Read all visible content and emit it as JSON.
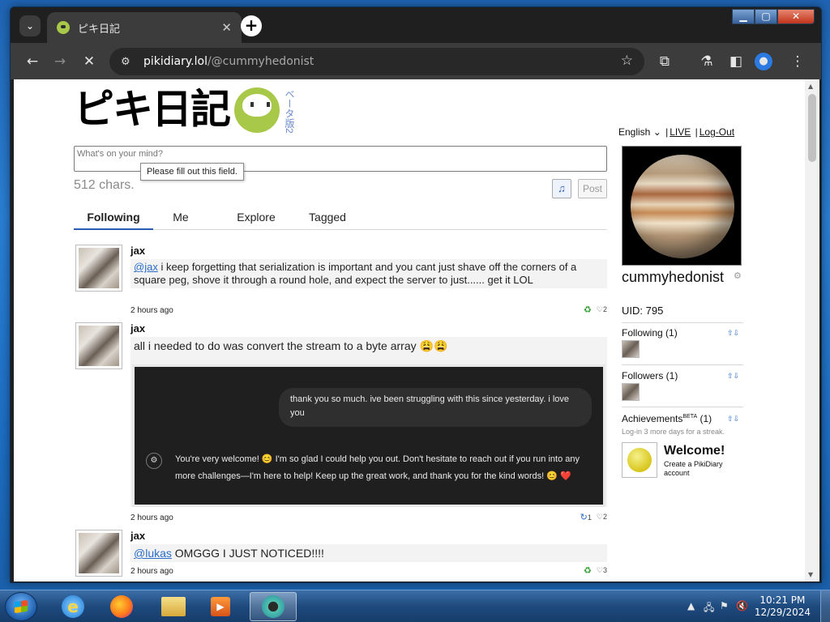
{
  "browser": {
    "tab_title": "ピキ日記",
    "tab_close": "✕",
    "new_tab": "+",
    "url_host": "pikidiary.lol",
    "url_path": "/@cummyhedonist"
  },
  "window_controls": {
    "minimize": "▁",
    "maximize": "▢",
    "close": "✕"
  },
  "header": {
    "logo_text": "ピキ日記",
    "beta_label": "ベータ版2",
    "language": "English",
    "language_caret": "⌄",
    "live_link": "LIVE",
    "logout_link": "Log-Out"
  },
  "compose": {
    "placeholder": "What's on your mind?",
    "tooltip": "Please fill out this field.",
    "chars_remaining": "512 chars.",
    "post_button": "Post",
    "music_icon": "♫"
  },
  "feed_tabs": [
    "Following",
    "Me",
    "Explore",
    "Tagged"
  ],
  "posts": [
    {
      "user": "jax",
      "mention": "@jax",
      "text": " i keep forgetting that serialization is important and you cant just shave off the corners of a square peg, shove it through a round hole, and expect the server to just...... get it LOL",
      "time": "2 hours ago",
      "repost_icon": "♻",
      "like_icon": "♡",
      "likes": "2"
    },
    {
      "user": "jax",
      "text": "all i needed to do was convert the stream to a byte array 😩😩",
      "embed": {
        "user_message": "thank you so much. ive been struggling with this since yesterday. i love you",
        "assistant_icon": "⚙",
        "assistant_message": "You're very welcome! 😊 I'm so glad I could help you out. Don't hesitate to reach out if you run into any more challenges—I'm here to help! Keep up the great work, and thank you for the kind words! 😊 ❤️"
      },
      "time": "2 hours ago",
      "repost_icon": "↻",
      "reposts": "1",
      "like_icon": "♡",
      "likes": "2"
    },
    {
      "user": "jax",
      "mention": "@lukas",
      "text": " OMGGG I JUST NOTICED!!!!",
      "time": "2 hours ago",
      "repost_icon": "♻",
      "like_icon": "♡",
      "likes": "3"
    }
  ],
  "sidebar": {
    "username": "cummyhedonist",
    "uid": "UID: 795",
    "following": "Following (1)",
    "followers": "Followers (1)",
    "achievements_label": "Achievements",
    "achievements_beta": "BETA",
    "achievements_count": " (1)",
    "streak_hint": "Log-in 3 more days for a streak.",
    "achievement_title": "Welcome!",
    "achievement_desc": "Create a PikiDiary account",
    "arrows": "⇧⇩"
  },
  "taskbar": {
    "time": "10:21 PM",
    "date": "12/29/2024"
  }
}
